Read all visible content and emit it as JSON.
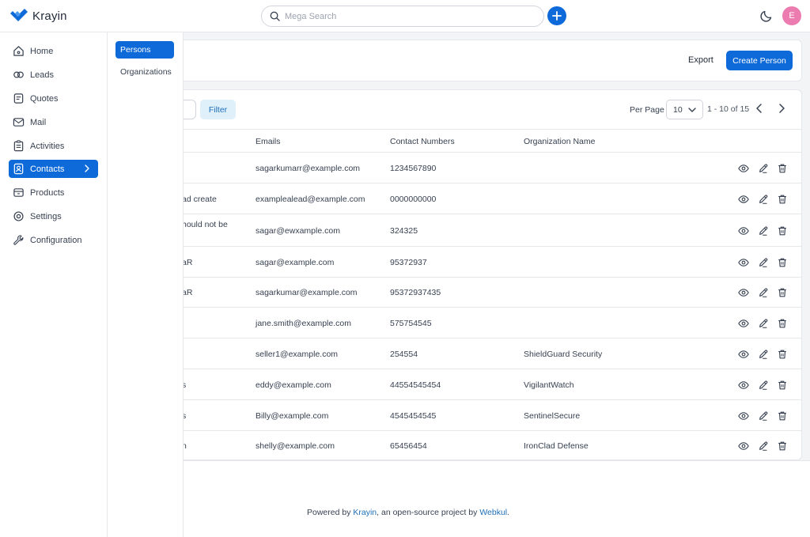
{
  "brand": {
    "name": "Krayin",
    "accent": "#0E6AD8"
  },
  "search": {
    "placeholder": "Mega Search"
  },
  "user": {
    "initial": "E",
    "avatar_color": "#EC7BB0"
  },
  "sidebar": {
    "items": [
      {
        "label": "Home",
        "icon": "home-icon"
      },
      {
        "label": "Leads",
        "icon": "leads-icon"
      },
      {
        "label": "Quotes",
        "icon": "quotes-icon"
      },
      {
        "label": "Mail",
        "icon": "mail-icon"
      },
      {
        "label": "Activities",
        "icon": "activities-icon"
      },
      {
        "label": "Contacts",
        "icon": "contacts-icon",
        "active": true
      },
      {
        "label": "Products",
        "icon": "products-icon"
      },
      {
        "label": "Settings",
        "icon": "settings-icon"
      },
      {
        "label": "Configuration",
        "icon": "configuration-icon"
      }
    ]
  },
  "subnav": {
    "items": [
      {
        "label": "Persons",
        "active": true
      },
      {
        "label": "Organizations"
      }
    ]
  },
  "header": {
    "export_label": "Export",
    "create_label": "Create Person"
  },
  "toolbar": {
    "filter_label": "Filter",
    "per_page_label": "Per Page",
    "per_page_value": "10",
    "pagination": "1 - 10 of 15"
  },
  "table": {
    "columns": [
      "Emails",
      "Contact Numbers",
      "Organization Name"
    ],
    "rows": [
      {
        "name": "",
        "email": "sagarkumarr@example.com",
        "phone": "1234567890",
        "org": ""
      },
      {
        "name": "ad create",
        "email": "examplealead@example.com",
        "phone": "0000000000",
        "org": ""
      },
      {
        "name": "hould not be",
        "email": "sagar@ewxample.com",
        "phone": "324325",
        "org": ""
      },
      {
        "name": "aR",
        "email": "sagar@example.com",
        "phone": "95372937",
        "org": ""
      },
      {
        "name": "aR",
        "email": "sagarkumar@example.com",
        "phone": "95372937435",
        "org": ""
      },
      {
        "name": "",
        "email": "jane.smith@example.com",
        "phone": "575754545",
        "org": ""
      },
      {
        "name": "",
        "email": "seller1@example.com",
        "phone": "254554",
        "org": "ShieldGuard Security"
      },
      {
        "name": "s",
        "email": "eddy@example.com",
        "phone": "44554545454",
        "org": "VigilantWatch"
      },
      {
        "name": "s",
        "email": "Billy@example.com",
        "phone": "4545454545",
        "org": "SentinelSecure"
      },
      {
        "name": "n",
        "email": "shelly@example.com",
        "phone": "65456454",
        "org": "IronClad Defense"
      }
    ]
  },
  "footer": {
    "prefix": "Powered by ",
    "link1": "Krayin",
    "middle": ", an open-source project by ",
    "link2": "Webkul",
    "suffix": "."
  }
}
